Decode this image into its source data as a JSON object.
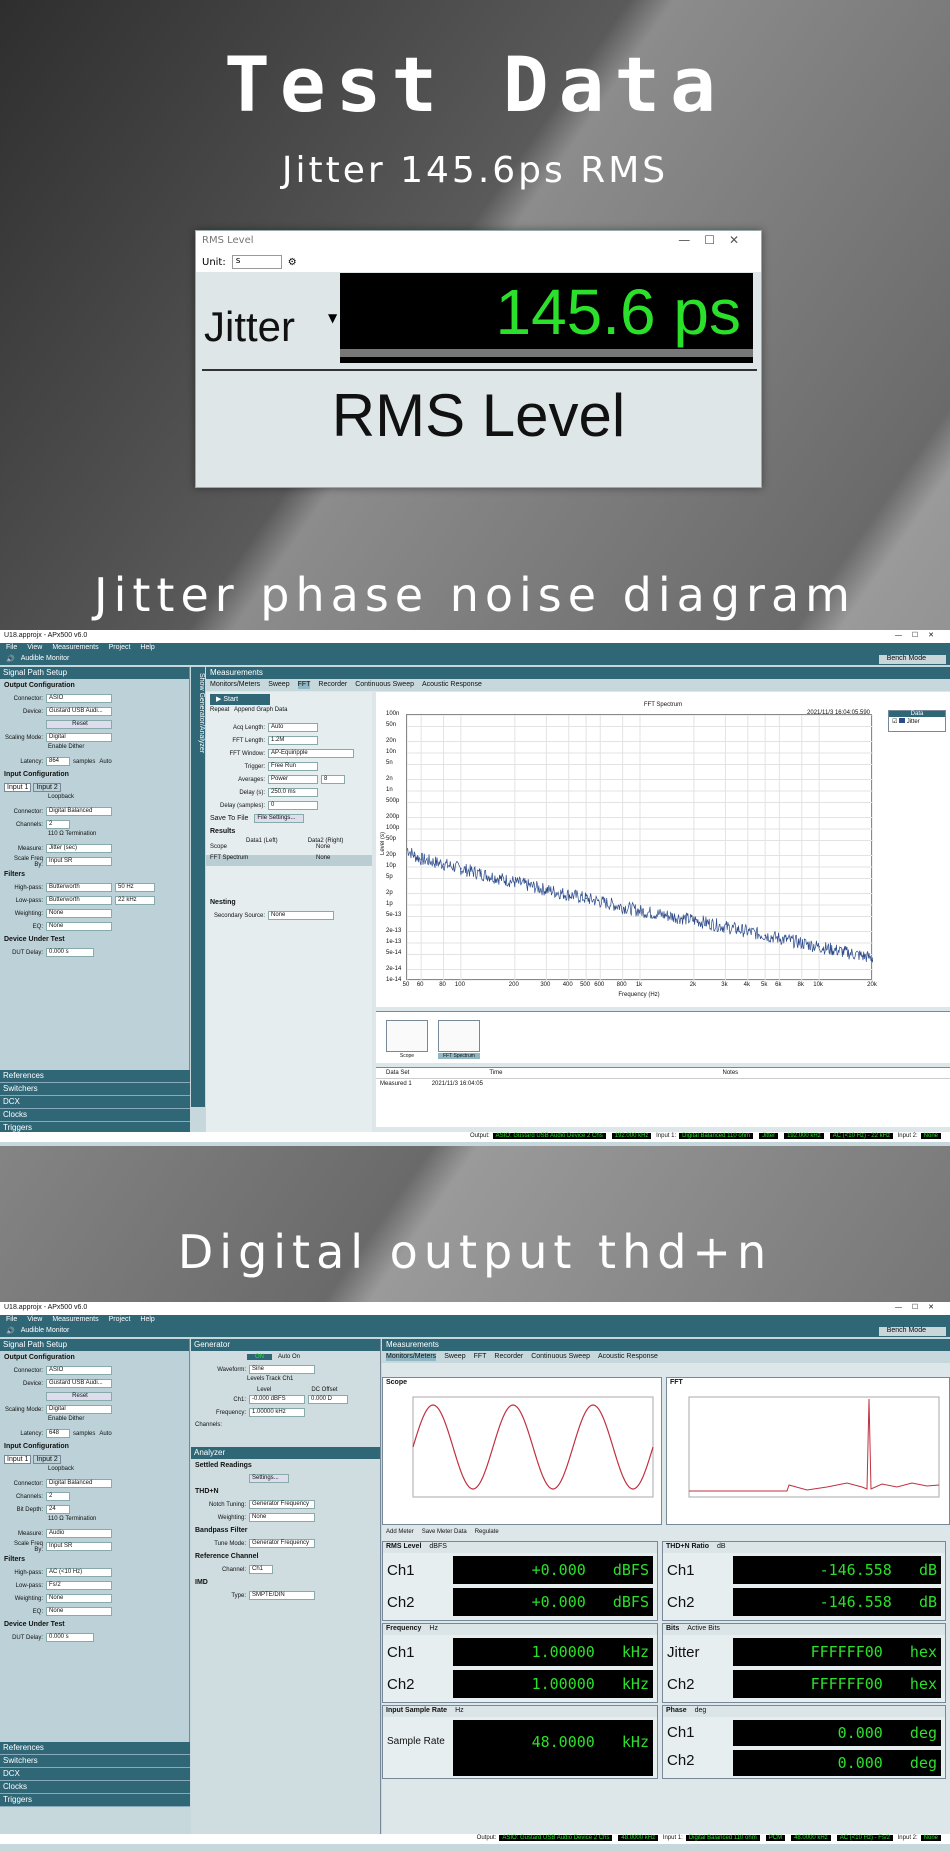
{
  "headings": {
    "main": "Test Data",
    "sub": "Jitter 145.6ps RMS",
    "jitter_section": "Jitter phase noise diagram",
    "digital_section": "Digital output thd+n"
  },
  "rms_window": {
    "title": "RMS Level",
    "unit_label": "Unit:",
    "unit_value": "s",
    "measure_label": "Jitter",
    "value": "145.6 ps",
    "caption": "RMS Level"
  },
  "apx1": {
    "title": "U18.approjx - APx500 v6.0",
    "menu": [
      "File",
      "View",
      "Measurements",
      "Project",
      "Help"
    ],
    "audible_monitor": "Audible Monitor",
    "bench_mode": "Bench Mode",
    "signal_path": "Signal Path Setup",
    "output_config": "Output Configuration",
    "connector_label": "Connector:",
    "connector": "ASIO",
    "device_label": "Device:",
    "device": "Gustard USB Audi...",
    "reset": "Reset",
    "scaling_label": "Scaling Mode:",
    "scaling": "Digital",
    "enable_dither": "Enable Dither",
    "latency_label": "Latency:",
    "latency": "864",
    "latency_unit": "samples",
    "auto": "Auto",
    "input_config": "Input Configuration",
    "input_tabs": [
      "Input 1",
      "Input 2"
    ],
    "loopback": "Loopback",
    "in_connector": "Digital Balanced",
    "channels_label": "Channels:",
    "channels": "2",
    "termination": "110 Ω Termination",
    "measure_label": "Measure:",
    "measure": "Jitter (sec)",
    "scale_label": "Scale Freq By:",
    "scale": "Input SR",
    "filters": "Filters",
    "highpass_label": "High-pass:",
    "highpass": "Butterworth",
    "highpass_val": "50 Hz",
    "lowpass_label": "Low-pass:",
    "lowpass": "Butterworth",
    "lowpass_val": "22 kHz",
    "weighting_label": "Weighting:",
    "weighting": "None",
    "eq_label": "EQ:",
    "eq": "None",
    "dut": "Device Under Test",
    "dut_delay_label": "DUT Delay:",
    "dut_delay": "0.000 s",
    "bottom_list": [
      "References",
      "Switchers",
      "DCX",
      "Clocks",
      "Triggers"
    ],
    "generator_strip": "Show Generator/Analyzer",
    "measurements": "Measurements",
    "tabs": [
      "Monitors/Meters",
      "Sweep",
      "FFT",
      "Recorder",
      "Continuous Sweep",
      "Acoustic Response"
    ],
    "start": "Start",
    "repeat": "Repeat",
    "append": "Append Graph Data",
    "acq_label": "Acq Length:",
    "acq": "Auto",
    "fftlen_label": "FFT Length:",
    "fftlen": "1.2M",
    "window_label": "FFT Window:",
    "window": "AP-Equiripple",
    "trigger_label": "Trigger:",
    "trigger": "Free Run",
    "averages_label": "Averages:",
    "averages": "Power",
    "averages_n": "8",
    "delay_label": "Delay (s):",
    "delay": "250.0 ms",
    "delay_samples_label": "Delay (samples):",
    "delay_samples": "0",
    "save_to_file": "Save To File",
    "file_settings": "File Settings...",
    "results": "Results",
    "results_cols": [
      "Data1 (Left)",
      "Data2 (Right)"
    ],
    "results_rows": [
      [
        "Scope",
        "None"
      ],
      [
        "FFT Spectrum",
        "None"
      ]
    ],
    "nesting": "Nesting",
    "secondary_label": "Secondary Source:",
    "secondary": "None",
    "plot_title": "FFT Spectrum",
    "plot_timestamp": "2021/11/3 16:04:05.590",
    "legend_title": "Data",
    "legend_item": "Jitter",
    "x_label": "Frequency (Hz)",
    "y_label": "Level (s)",
    "thumbs": [
      "Scope",
      "FFT Spectrum"
    ],
    "dataset_cols": [
      "Data Set",
      "Time",
      "Notes"
    ],
    "dataset_row": [
      "Measured 1",
      "2021/11/3 16:04:05",
      ""
    ],
    "status": {
      "output_label": "Output:",
      "output": "ASIO: Gustard USB Audio Device 2 Chs",
      "rate": "192.000 kHz",
      "input_label": "Input 1:",
      "input": "Digital Balanced 110 ohm",
      "jitter": "Jitter",
      "in_rate": "192.000 kHz",
      "coupling": "AC (<10 Hz) - 22 kHz",
      "input2_label": "Input 2:",
      "input2": "None"
    }
  },
  "chart_data": {
    "type": "line",
    "title": "FFT Spectrum",
    "xlabel": "Frequency (Hz)",
    "ylabel": "Level (s)",
    "x_scale": "log",
    "y_scale": "log",
    "xlim": [
      50,
      20000
    ],
    "ylim": [
      1e-14,
      1e-07
    ],
    "x_ticks": [
      "50",
      "60",
      "80",
      "100",
      "200",
      "300",
      "400",
      "500",
      "600",
      "800",
      "1k",
      "2k",
      "3k",
      "4k",
      "5k",
      "6k",
      "8k",
      "10k",
      "20k"
    ],
    "y_ticks": [
      "100n",
      "50n",
      "20n",
      "10n",
      "5n",
      "2n",
      "1n",
      "500p",
      "200p",
      "100p",
      "50p",
      "20p",
      "10p",
      "5p",
      "2p",
      "1p",
      "5e-13",
      "2e-13",
      "1e-13",
      "5e-14",
      "2e-14",
      "1e-14"
    ],
    "series": [
      {
        "name": "Jitter",
        "x": [
          50,
          55,
          60,
          80,
          100,
          200,
          300,
          500,
          1000,
          2000,
          5000,
          10000,
          20000
        ],
        "y": [
          3e-11,
          2e-11,
          1.6e-11,
          1.2e-11,
          9e-12,
          4e-12,
          2.5e-12,
          1.5e-12,
          7e-13,
          4e-13,
          1.6e-13,
          8e-14,
          4e-14
        ]
      }
    ],
    "grid": true,
    "legend": "top-right"
  },
  "apx2": {
    "title": "U18.approjx - APx500 v6.0",
    "generator": "Generator",
    "on": "ON",
    "auto_on": "Auto On",
    "waveform_label": "Waveform:",
    "waveform": "Sine",
    "levels_track": "Levels Track Ch1",
    "level_col": "Level",
    "dc_col": "DC Offset",
    "ch1_label": "Ch1:",
    "ch1_level": "-0.000 dBFS",
    "ch1_dc": "0.000 D",
    "freq_label": "Frequency:",
    "freq": "1.00000 kHz",
    "channels_label": "Channels:",
    "analyzer": "Analyzer",
    "settled": "Settled Readings",
    "settings": "Settings...",
    "thdn": "THD+N",
    "notch_label": "Notch Tuning:",
    "notch": "Generator Frequency",
    "weighting_label": "Weighting:",
    "weighting": "None",
    "bandpass": "Bandpass Filter",
    "tune_label": "Tune Mode:",
    "tune": "Generator Frequency",
    "refch": "Reference Channel",
    "channel_label": "Channel:",
    "channel": "Ch1",
    "imd": "IMD",
    "type_label": "Type:",
    "type": "SMPTE/DIN",
    "in_measure": "Audio",
    "bit_depth_label": "Bit Depth:",
    "bit_depth": "24",
    "latency": "648",
    "in_highpass": "AC (<10 Hz)",
    "in_lowpass": "Fs/2",
    "scope_title": "Scope",
    "fft_title": "FFT",
    "add_meter": "Add Meter",
    "save_meter": "Save Meter Data",
    "regulate": "Regulate",
    "meters": {
      "rms": {
        "title": "RMS Level",
        "unit": "dBFS",
        "ch1": "+0.000",
        "ch2": "+0.000",
        "u": "dBFS"
      },
      "thdn": {
        "title": "THD+N Ratio",
        "unit": "dB",
        "ch1": "-146.558",
        "ch2": "-146.558",
        "u": "dB"
      },
      "freq": {
        "title": "Frequency",
        "unit": "Hz",
        "ch1": "1.00000",
        "ch2": "1.00000",
        "u": "kHz"
      },
      "bits": {
        "title": "Bits",
        "unit": "Active Bits",
        "ch1_label": "Jitter",
        "ch1": "FFFFFF00",
        "ch2": "FFFFFF00",
        "u": "hex"
      },
      "rate": {
        "title": "Input Sample Rate",
        "unit": "Hz",
        "label": "Sample Rate",
        "val": "48.0000",
        "u": "kHz"
      },
      "phase": {
        "title": "Phase",
        "unit": "deg",
        "ch1": "0.000",
        "ch2": "0.000",
        "u": "deg"
      }
    },
    "status": {
      "output": "ASIO: Gustard USB Audio Device 2 Chs",
      "rate": "48.0000 kHz",
      "input": "Digital Balanced 110 ohm",
      "pcm": "PCM",
      "in_rate": "48.0000 kHz",
      "coupling": "AC (<10 Hz) - Fs/2",
      "input2": "None"
    }
  }
}
